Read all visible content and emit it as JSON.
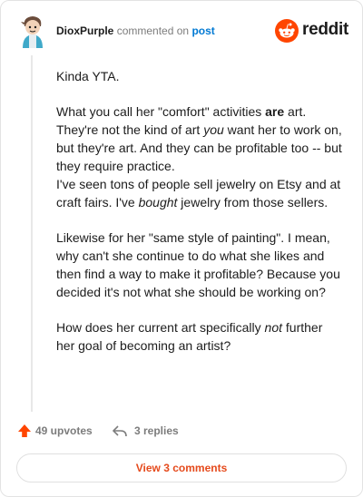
{
  "header": {
    "username": "DioxPurple",
    "commented_on": "commented on",
    "post_link": "post",
    "brand": "reddit"
  },
  "comment": {
    "paragraphs": [
      [
        {
          "t": "Kinda YTA."
        }
      ],
      [
        {
          "t": "What you call her \"comfort\" activities "
        },
        {
          "t": "are",
          "style": "b"
        },
        {
          "t": " art. They're not the kind of art "
        },
        {
          "t": "you",
          "style": "i"
        },
        {
          "t": " want her to work on, but they're art. And they can be profitable too -- but they require practice."
        },
        {
          "t": "\n"
        },
        {
          "t": "I've seen tons of people sell jewelry on Etsy and at craft fairs. I've "
        },
        {
          "t": "bought",
          "style": "i"
        },
        {
          "t": " jewelry from those sellers."
        }
      ],
      [
        {
          "t": "Likewise for her \"same style of painting\". I mean, why can't she continue to do what she likes and then find a way to make it profitable? Because you decided it's not what she should be working on?"
        }
      ],
      [
        {
          "t": "How does her current art specifically "
        },
        {
          "t": "not",
          "style": "i"
        },
        {
          "t": " further her goal of becoming an artist?"
        }
      ]
    ]
  },
  "footer": {
    "upvotes": "49 upvotes",
    "replies": "3 replies",
    "view_comments": "View 3 comments"
  },
  "colors": {
    "upvote_orange": "#ff4500",
    "link_blue": "#0079d3",
    "view_comments_text": "#e54a1c"
  }
}
